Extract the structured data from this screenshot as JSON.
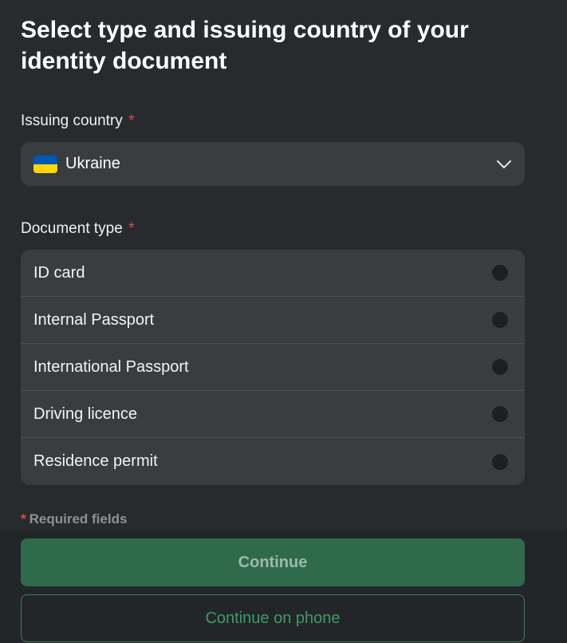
{
  "page": {
    "title": "Select type and issuing country of your identity document"
  },
  "issuing_country": {
    "label": "Issuing country",
    "required_mark": "*",
    "selected": "Ukraine",
    "flag_colors": [
      "#0057b7",
      "#ffd700"
    ]
  },
  "document_type": {
    "label": "Document type",
    "required_mark": "*",
    "options": [
      {
        "label": "ID card",
        "selected": false
      },
      {
        "label": "Internal Passport",
        "selected": false
      },
      {
        "label": "International Passport",
        "selected": false
      },
      {
        "label": "Driving licence",
        "selected": false
      },
      {
        "label": "Residence permit",
        "selected": false
      }
    ]
  },
  "footer": {
    "required_mark": "*",
    "required_note": "Required fields",
    "continue_label": "Continue",
    "continue_phone_label": "Continue on phone"
  },
  "colors": {
    "background": "#272b2d",
    "surface": "#393d3f",
    "required": "#e5484d",
    "primary": "#2f6b4a",
    "primary_text": "#9fb9a9",
    "secondary_border": "#3c7d58",
    "secondary_text": "#3f9a67"
  },
  "icons": {
    "country_flag": "ukraine-flag-icon",
    "dropdown": "chevron-down-icon",
    "radio": "radio-unchecked-icon"
  }
}
